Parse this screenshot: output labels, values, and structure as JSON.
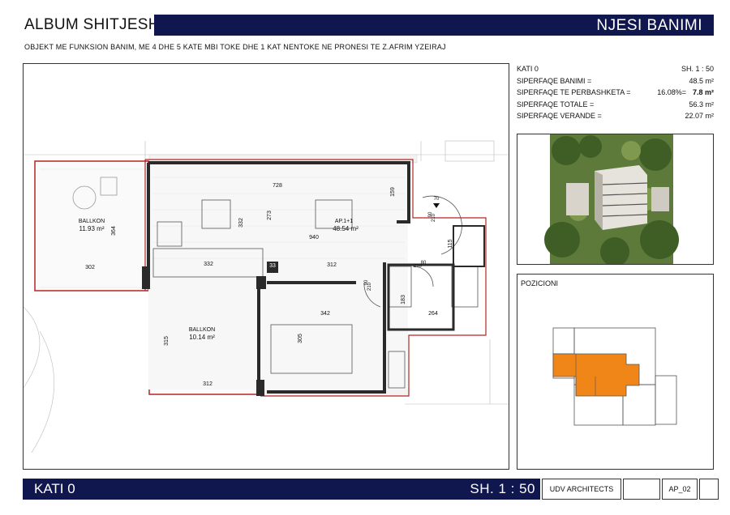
{
  "header": {
    "album_title": "ALBUM SHITJESH",
    "unit_type": "NJESI BANIMI",
    "subtitle": "OBJEKT ME FUNKSION BANIM, ME 4 DHE 5 KATE MBI TOKE DHE 1 KAT NENTOKE NE PRONESI TE Z.AFRIM YZEIRAJ"
  },
  "info": {
    "floor": "KATI 0",
    "scale": "SH.  1 : 50",
    "rows": [
      {
        "label": "SIPERFAQE BANIMI =",
        "mid": "",
        "value": "48.5 m²",
        "bold": false
      },
      {
        "label": "SIPERFAQE TE PERBASHKETA =",
        "mid": "16.08%=",
        "value": "7.8 m²",
        "bold": true
      },
      {
        "label": "SIPERFAQE TOTALE =",
        "mid": "",
        "value": "56.3 m²",
        "bold": false
      },
      {
        "label": "SIPERFAQE VERANDE =",
        "mid": "",
        "value": "22.07 m²",
        "bold": false
      }
    ]
  },
  "plan": {
    "balcony1": {
      "name": "BALLKON",
      "area": "11.93 m²"
    },
    "balcony2": {
      "name": "BALLKON",
      "area": "10.14 m²"
    },
    "apartment": {
      "name": "AP.1+1",
      "area": "48.54 m²"
    },
    "dims": {
      "d364": "364",
      "d302": "302",
      "d332a": "332",
      "d332b": "332",
      "d273": "273",
      "d728": "728",
      "d159": "159",
      "d940": "940",
      "d312a": "312",
      "d33": "33",
      "d342": "342",
      "d305": "305",
      "d315": "315",
      "d312b": "312",
      "d264": "264",
      "d183": "183",
      "d115": "115",
      "d210a": "210",
      "d210b": "210",
      "d210c": "210",
      "d90a": "90",
      "d90b": "90",
      "d80": "80",
      "d70": "70"
    }
  },
  "position": {
    "label": "POZICIONI"
  },
  "footer": {
    "floor": "KATI 0",
    "scale": "SH.   1 : 50",
    "firm": "UDV ARCHITECTS",
    "sheet": "AP_02"
  },
  "colors": {
    "navy": "#10174e",
    "orange": "#f08518",
    "wall": "#2a2a2a",
    "red_outline": "#b52424"
  }
}
